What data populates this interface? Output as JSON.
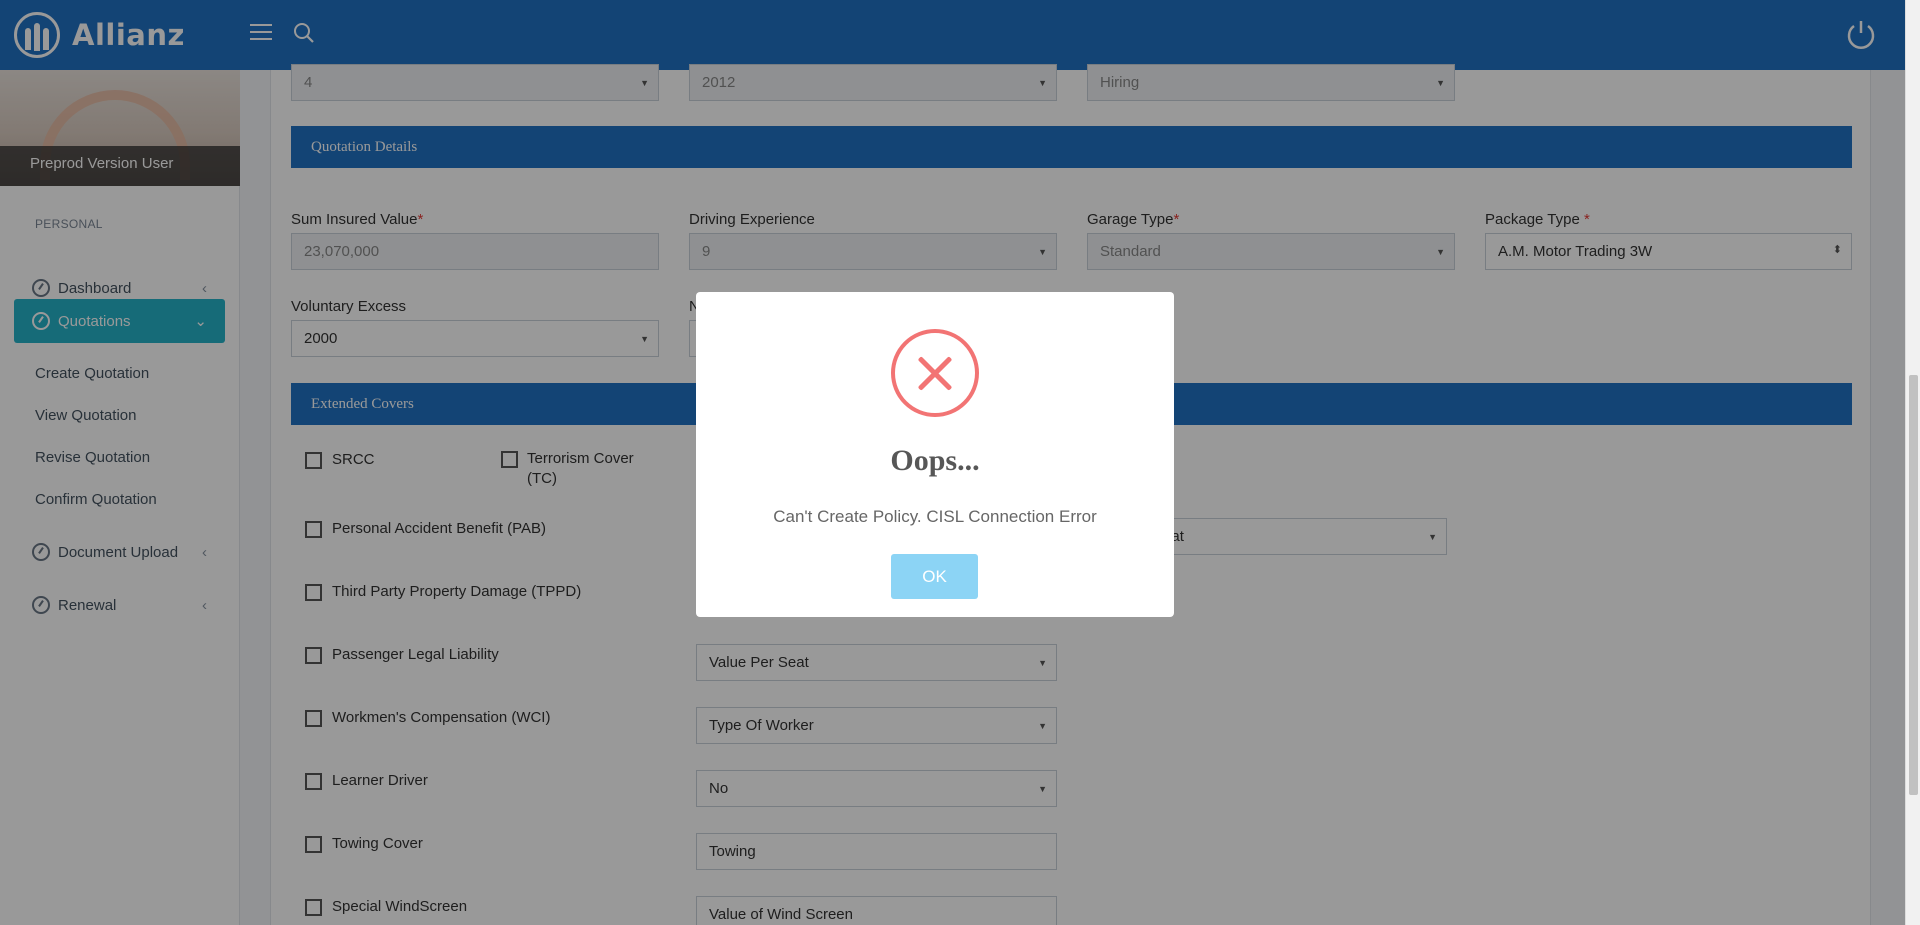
{
  "header": {
    "brand": "Allianz"
  },
  "sidebar": {
    "username": "Preprod Version User",
    "menu_header": "PERSONAL",
    "items": [
      {
        "label": "Dashboard"
      },
      {
        "label": "Quotations"
      },
      {
        "label": "Document Upload"
      },
      {
        "label": "Renewal"
      }
    ],
    "sub_items": [
      "Create Quotation",
      "View Quotation",
      "Revise Quotation",
      "Confirm Quotation"
    ]
  },
  "top_row": {
    "field1": "4",
    "field2": "2012",
    "field3": "Hiring"
  },
  "quotation_details": {
    "title": "Quotation Details",
    "sum_insured_label": "Sum Insured Value",
    "sum_insured_value": "23,070,000",
    "driving_exp_label": "Driving Experience",
    "driving_exp_value": "9",
    "garage_type_label": "Garage Type",
    "garage_type_value": "Standard",
    "package_type_label": "Package Type ",
    "package_type_value": "A.M. Motor Trading 3W",
    "voluntary_excess_label": "Voluntary Excess",
    "voluntary_excess_value": "2000",
    "partial_label": "N",
    "required_mark": "*"
  },
  "extended_covers": {
    "title": "Extended Covers",
    "srcc": "SRCC",
    "terrorism": "Terrorism Cover (TC)",
    "pab": "Personal Accident Benefit (PAB)",
    "pab_select_partial": "Seat",
    "tppd": "Third Party Property Damage (TPPD)",
    "pll": "Passenger Legal Liability",
    "pll_select": "Value Per Seat",
    "wci": "Workmen's Compensation (WCI)",
    "wci_select": "Type Of Worker",
    "learner": "Learner Driver",
    "learner_select": "No",
    "towing": "Towing Cover",
    "towing_input": "Towing",
    "windscreen": "Special WindScreen",
    "windscreen_input": "Value of Wind Screen"
  },
  "modal": {
    "title": "Oops...",
    "message": "Can't Create Policy. CISL Connection Error",
    "ok_label": "OK"
  },
  "colors": {
    "primary": "#2172c3",
    "active_nav": "#26b3c9",
    "error": "#f27474",
    "ok_button": "#8cd4f5"
  }
}
